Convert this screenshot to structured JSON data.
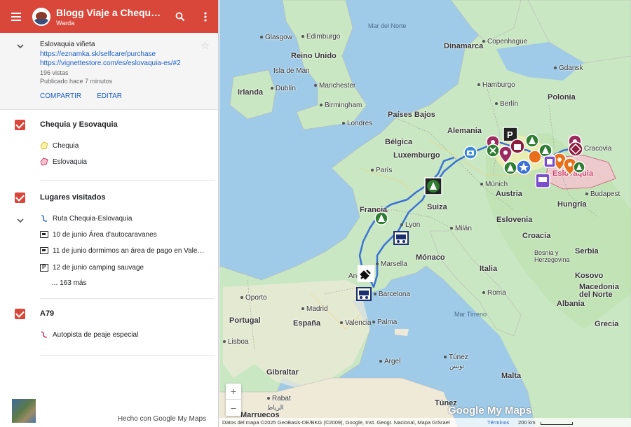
{
  "header": {
    "title": "Blogg Viaje a Chequia…",
    "subtitle": "Warda"
  },
  "info": {
    "title": "Eslovaquia viñeta",
    "link1": "https://eznamka.sk/selfcare/purchase",
    "link2": "https://vignettestore.com/es/eslovaquia-es/#2",
    "views": "196 vistas",
    "published": "Publicado hace 7 minutos",
    "share_label": "COMPARTIR",
    "edit_label": "EDITAR"
  },
  "layers": [
    {
      "title": "Chequia y Esovaquia",
      "items": [
        "Chequia",
        "Eslovaquia"
      ]
    },
    {
      "title": "Lugares visitados",
      "route": "Ruta Chequia-Eslovaquia",
      "items": [
        "10 de junio Área d'autocaravanes",
        "11 de junio dormimos an área de pago en Vale…",
        "12 de junio camping sauvage"
      ],
      "more": "... 163 más"
    },
    {
      "title": "A79",
      "items": [
        "Autopista de peaje especial"
      ]
    }
  ],
  "footer": {
    "made_with": "Hecho con Google My Maps"
  },
  "map": {
    "labels": {
      "mar_del_norte": "Mar del Norte",
      "glasgow": "Glasgow",
      "edinburgh": "Edimburgo",
      "copenhague": "Copenhague",
      "dinamarca": "Dinamarca",
      "reino_unido": "Reino Unido",
      "isla_de_man": "Isla de Man",
      "gdansk": "Gdansk",
      "hamburgo": "Hamburgo",
      "irlanda": "Irlanda",
      "dublin": "Dublín",
      "manchester": "Manchester",
      "polonia": "Polonia",
      "birmingham": "Birmingham",
      "berlin": "Berlín",
      "paises_bajos": "Países Bajos",
      "londres": "Londres",
      "alemania": "Alemania",
      "belgica": "Bélgica",
      "cracovia": "Cracovia",
      "luxemburgo": "Luxemburgo",
      "eslovaquia": "Eslovaquia",
      "paris": "París",
      "munich": "Múnich",
      "budapest": "Budapest",
      "austria": "Austria",
      "suiza": "Suiza",
      "hungria": "Hungría",
      "francia": "Francia",
      "eslovenia": "Eslovenia",
      "lyon": "Lyon",
      "milan": "Milán",
      "croacia": "Croacia",
      "monaco": "Mónaco",
      "serbia": "Serbia",
      "italia": "Italia",
      "marsella": "Marsella",
      "bosnia": "Bosnia y\nHerzegovina",
      "oporto": "Oporto",
      "andorra": "Andorra",
      "kosovo": "Kosovo",
      "barcelona": "Barcelona",
      "roma": "Roma",
      "macedonia": "Macedonia\ndel Norte",
      "madrid": "Madrid",
      "albania": "Albania",
      "portugal": "Portugal",
      "espana": "España",
      "valencia": "Valencia",
      "palma": "Palma",
      "mar_tirreno": "Mar Tirreno",
      "grecia": "Grecia",
      "lisboa": "Lisboa",
      "argel": "Argel",
      "tunez": "Túnez",
      "tunez_ar": "تونس",
      "gibraltar": "Gibraltar",
      "malta": "Malta",
      "rabat": "Rabat",
      "rabat_ar": "الرباط",
      "marruecos": "Marruecos",
      "tunez_country": "Túnez"
    },
    "attribution": "Datos del mapa ©2025 GeoBasis-DE/BKG (©2009), Google, Inst. Geogr. Nacional, Mapa GISrael",
    "terms": "Términos",
    "scale": "200 km",
    "brand": "Google My Maps",
    "zoom_in": "+",
    "zoom_out": "−"
  },
  "colors": {
    "header": "#d9473a",
    "link": "#1a5fc8",
    "route": "#3a72d6",
    "water": "#9fcbe8",
    "land": "#c9e7c2",
    "slovakia_fill": "#f4c6d0"
  }
}
